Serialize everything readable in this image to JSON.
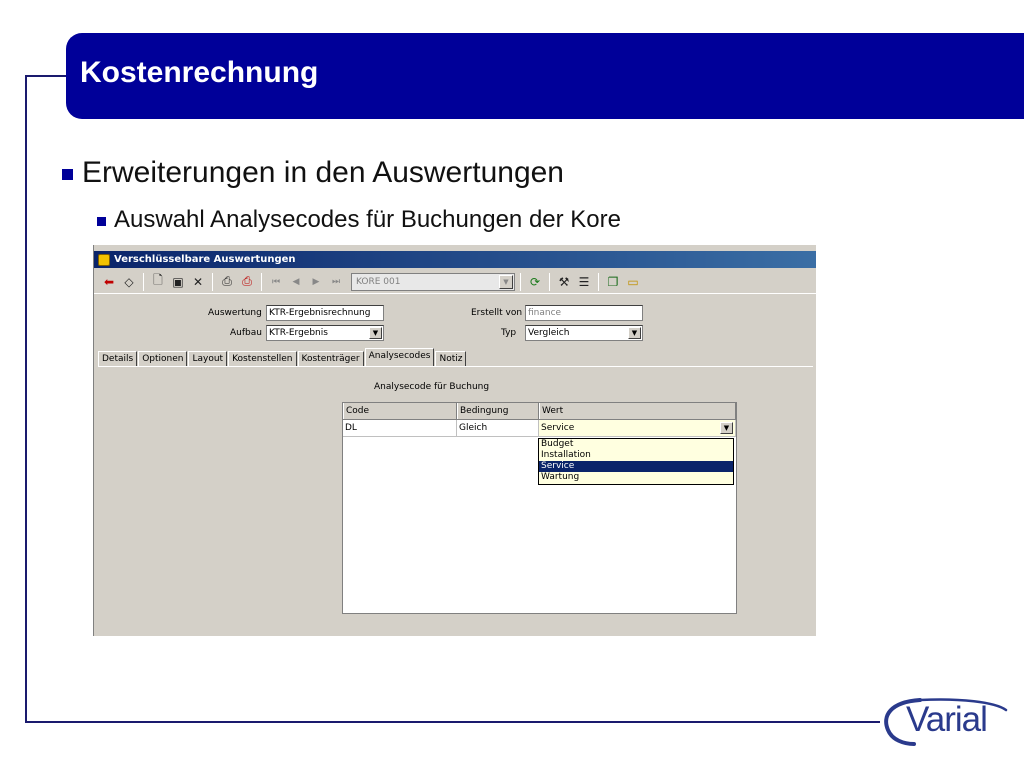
{
  "slide": {
    "title": "Kostenrechnung",
    "bullet_main": "Erweiterungen in den Auswertungen",
    "bullet_sub": "Auswahl Analysecodes für Buchungen der Kore",
    "logo_text": "Varial"
  },
  "window": {
    "title": "Verschlüsselbare Auswertungen",
    "toolbar": {
      "record_combo_value": "KORE 001",
      "icons": [
        "arrow-left-icon",
        "diamond-icon",
        "new-document-icon",
        "save-icon",
        "delete-icon",
        "print-icon",
        "print-preview-icon",
        "first-record-icon",
        "previous-record-icon",
        "next-record-icon",
        "last-record-icon",
        "refresh-icon",
        "tools-icon",
        "list-icon",
        "copy-icon",
        "folder-icon"
      ],
      "nav": {
        "first": "⏮",
        "prev": "◀",
        "next": "▶",
        "last": "⏭"
      }
    },
    "form": {
      "auswertung_label": "Auswertung",
      "auswertung_value": "KTR-Ergebnisrechnung",
      "aufbau_label": "Aufbau",
      "aufbau_value": "KTR-Ergebnis",
      "erstellt_von_label": "Erstellt von",
      "erstellt_von_value": "finance",
      "typ_label": "Typ",
      "typ_value": "Vergleich"
    },
    "tabs": [
      "Details",
      "Optionen",
      "Layout",
      "Kostenstellen",
      "Kostenträger",
      "Analysecodes",
      "Notiz"
    ],
    "active_tab": "Analysecodes",
    "section_label": "Analysecode für Buchung",
    "grid": {
      "columns": [
        "Code",
        "Bedingung",
        "Wert"
      ],
      "rows": [
        {
          "code": "DL",
          "bedingung": "Gleich",
          "wert": "Service"
        }
      ]
    },
    "dropdown_options": [
      "Budget",
      "Installation",
      "Service",
      "Wartung"
    ],
    "dropdown_selected": "Service",
    "colors": {
      "title_bar": "#000099",
      "selection": "#0a246a",
      "cell_highlight": "#ffffe0"
    }
  }
}
